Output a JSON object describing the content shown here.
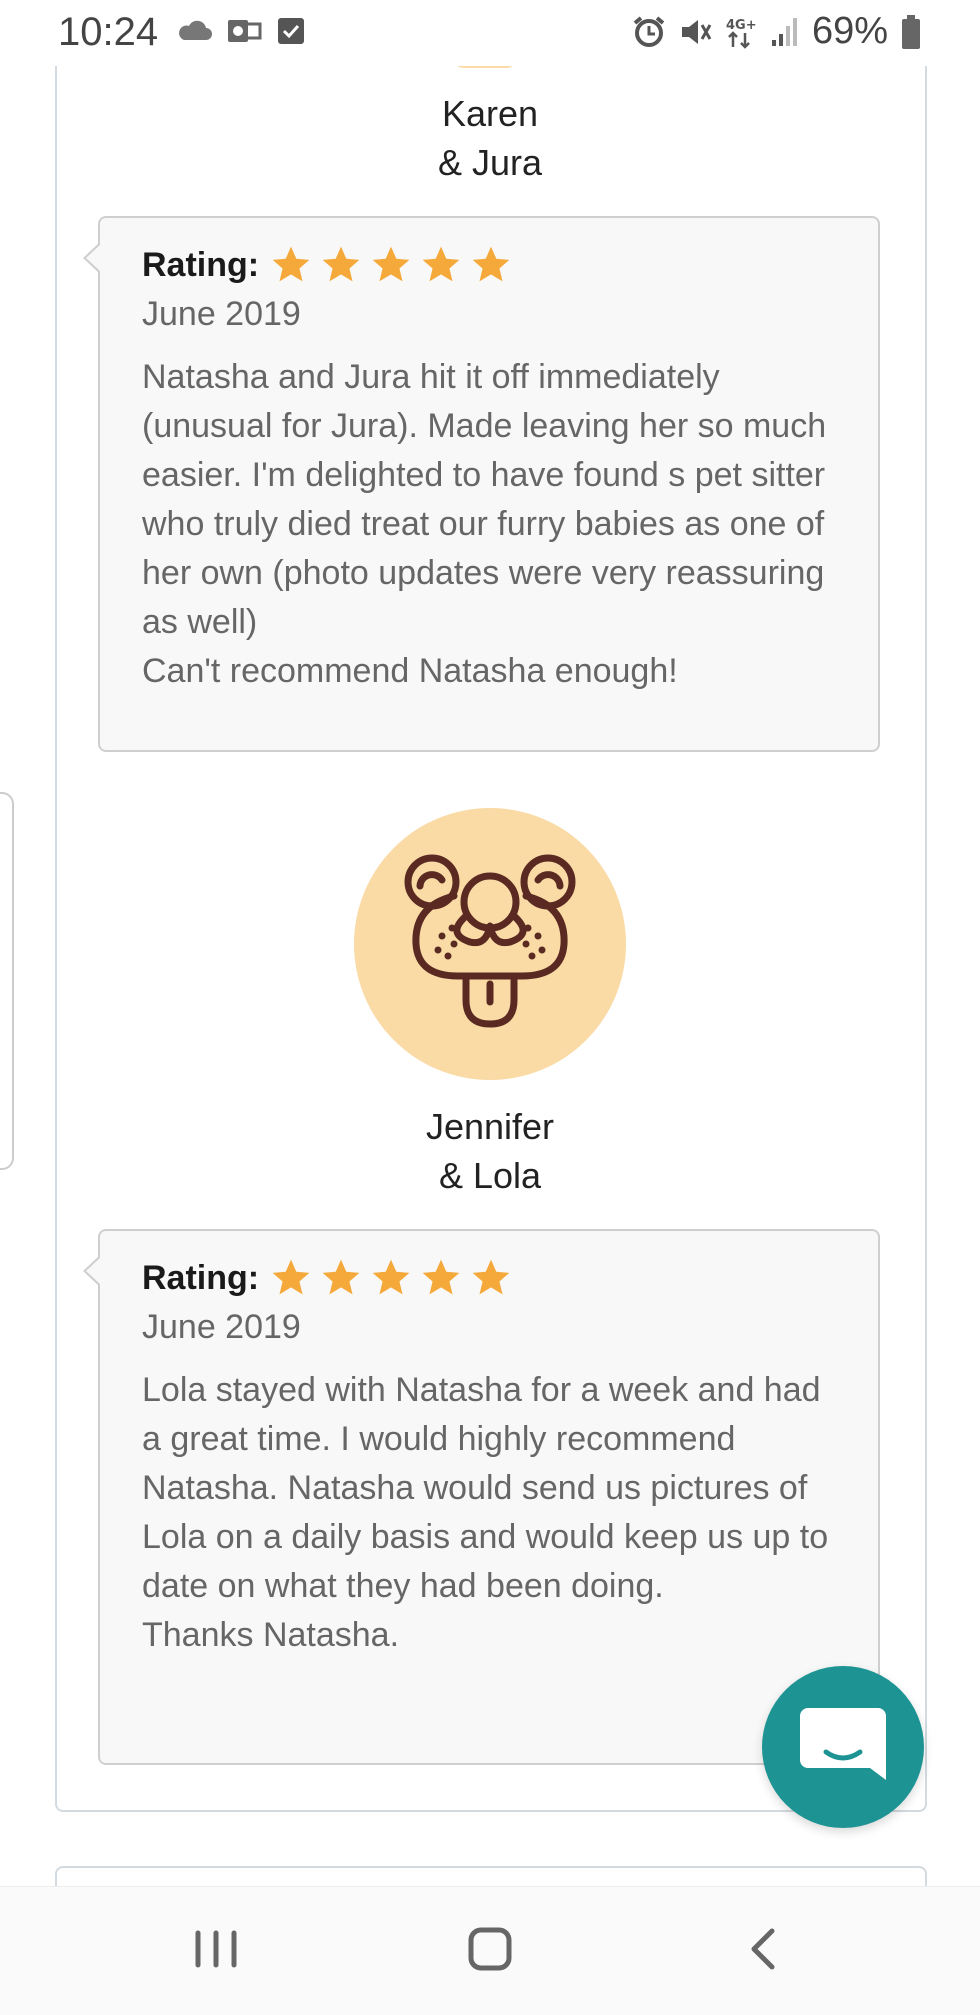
{
  "status_bar": {
    "time": "10:24",
    "battery_percent": "69%",
    "left_icons": [
      "cloud-icon",
      "outlook-icon",
      "checkbox-icon"
    ],
    "right_icons": [
      "alarm-icon",
      "mute-icon",
      "4g-data-icon",
      "signal-icon",
      "battery-icon"
    ]
  },
  "reviews": [
    {
      "reviewer": "Karen",
      "pet": "& Jura",
      "rating_label": "Rating:",
      "stars": 5,
      "date": "June 2019",
      "text": "Natasha and Jura hit it off immediately (unusual for Jura). Made leaving her so much easier. I'm delighted to have found s pet sitter who truly died treat our furry babies as one of her own (photo updates were very reassuring as well)\nCan't recommend Natasha enough!"
    },
    {
      "reviewer": "Jennifer",
      "pet": "& Lola",
      "rating_label": "Rating:",
      "stars": 5,
      "date": "June 2019",
      "text": "Lola stayed with Natasha for a week and had a great time. I would highly recommend Natasha. Natasha would send us pictures of Lola on a daily basis and would keep us up to date on what they had been doing.\nThanks Natasha."
    }
  ],
  "colors": {
    "star": "#f5a93a",
    "avatar_bg": "#fadba6",
    "avatar_line": "#5a2a22",
    "chat_button": "#1e9393",
    "card_border": "#d3dbe0"
  },
  "chat_button_icon": "chat-bubble-icon",
  "nav_bar": {
    "buttons": [
      "recent-apps-icon",
      "home-icon",
      "back-icon"
    ]
  }
}
